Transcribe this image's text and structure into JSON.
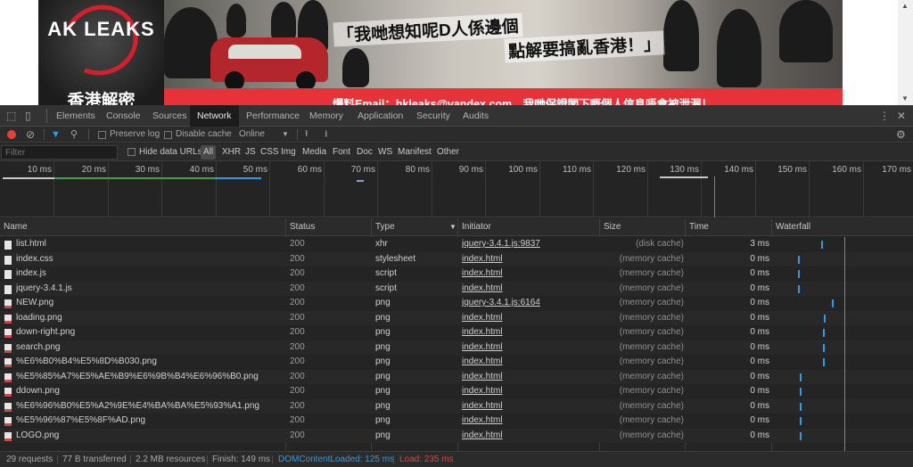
{
  "page": {
    "logo_text": "AK LEAKS",
    "logo_caption": "香港解密",
    "headline_line1": "「我哋想知呢D人係邊個",
    "headline_line2": "點解要搞亂香港！」",
    "contact_text": "爆料Email：hkleaks@vandex.com，我哋保證閣下嘅個人信息唔會被泄漏！"
  },
  "devtools": {
    "tabs": [
      "Elements",
      "Console",
      "Sources",
      "Network",
      "Performance",
      "Memory",
      "Application",
      "Security",
      "Audits"
    ],
    "active_tab": "Network",
    "toolbar": {
      "preserve_log": "Preserve log",
      "disable_cache": "Disable cache",
      "throttle": "Online"
    },
    "filter": {
      "placeholder": "Filter",
      "hide_data_urls": "Hide data URLs",
      "all": "All",
      "types": [
        "XHR",
        "JS",
        "CSS",
        "Img",
        "Media",
        "Font",
        "Doc",
        "WS",
        "Manifest",
        "Other"
      ]
    },
    "overview_ticks": [
      "10 ms",
      "20 ms",
      "30 ms",
      "40 ms",
      "50 ms",
      "60 ms",
      "70 ms",
      "80 ms",
      "90 ms",
      "100 ms",
      "110 ms",
      "120 ms",
      "130 ms",
      "140 ms",
      "150 ms",
      "160 ms",
      "170 ms"
    ],
    "columns": {
      "name": "Name",
      "status": "Status",
      "type": "Type",
      "initiator": "Initiator",
      "size": "Size",
      "time": "Time",
      "waterfall": "Waterfall"
    },
    "rows": [
      {
        "name": "list.html",
        "status": "200",
        "type": "xhr",
        "initiator": "jquery-3.4.1.js:9837",
        "size": "(disk cache)",
        "time": "3 ms",
        "wf": 0.35
      },
      {
        "name": "index.css",
        "status": "200",
        "type": "stylesheet",
        "initiator": "index.html",
        "size": "(memory cache)",
        "time": "0 ms",
        "wf": 0.18
      },
      {
        "name": "index.js",
        "status": "200",
        "type": "script",
        "initiator": "index.html",
        "size": "(memory cache)",
        "time": "0 ms",
        "wf": 0.18
      },
      {
        "name": "jquery-3.4.1.js",
        "status": "200",
        "type": "script",
        "initiator": "index.html",
        "size": "(memory cache)",
        "time": "0 ms",
        "wf": 0.18
      },
      {
        "name": "NEW.png",
        "status": "200",
        "type": "png",
        "initiator": "jquery-3.4.1.js:6164",
        "size": "(memory cache)",
        "time": "0 ms",
        "wf": 0.43
      },
      {
        "name": "loading.png",
        "status": "200",
        "type": "png",
        "initiator": "index.html",
        "size": "(memory cache)",
        "time": "0 ms",
        "wf": 0.37
      },
      {
        "name": "down-right.png",
        "status": "200",
        "type": "png",
        "initiator": "index.html",
        "size": "(memory cache)",
        "time": "0 ms",
        "wf": 0.36
      },
      {
        "name": "search.png",
        "status": "200",
        "type": "png",
        "initiator": "index.html",
        "size": "(memory cache)",
        "time": "0 ms",
        "wf": 0.36
      },
      {
        "name": "%E6%B0%B4%E5%8D%B030.png",
        "status": "200",
        "type": "png",
        "initiator": "index.html",
        "size": "(memory cache)",
        "time": "0 ms",
        "wf": 0.36
      },
      {
        "name": "%E5%85%A7%E5%AE%B9%E6%9B%B4%E6%96%B0.png",
        "status": "200",
        "type": "png",
        "initiator": "index.html",
        "size": "(memory cache)",
        "time": "0 ms",
        "wf": 0.19
      },
      {
        "name": "ddown.png",
        "status": "200",
        "type": "png",
        "initiator": "index.html",
        "size": "(memory cache)",
        "time": "0 ms",
        "wf": 0.19
      },
      {
        "name": "%E6%96%B0%E5%A2%9E%E4%BA%BA%E5%93%A1.png",
        "status": "200",
        "type": "png",
        "initiator": "index.html",
        "size": "(memory cache)",
        "time": "0 ms",
        "wf": 0.19
      },
      {
        "name": "%E5%96%87%E5%8F%AD.png",
        "status": "200",
        "type": "png",
        "initiator": "index.html",
        "size": "(memory cache)",
        "time": "0 ms",
        "wf": 0.19
      },
      {
        "name": "LOGO.png",
        "status": "200",
        "type": "png",
        "initiator": "index.html",
        "size": "(memory cache)",
        "time": "0 ms",
        "wf": 0.19
      }
    ],
    "status": {
      "requests": "29 requests",
      "transferred": "77 B transferred",
      "resources": "2.2 MB resources",
      "finish": "Finish: 149 ms",
      "dcl": "DOMContentLoaded: 125 ms",
      "load": "Load: 235 ms"
    },
    "colors": {
      "dcl": "#2f9be0",
      "load": "#e0433a",
      "bar": "#2f9be0"
    }
  }
}
